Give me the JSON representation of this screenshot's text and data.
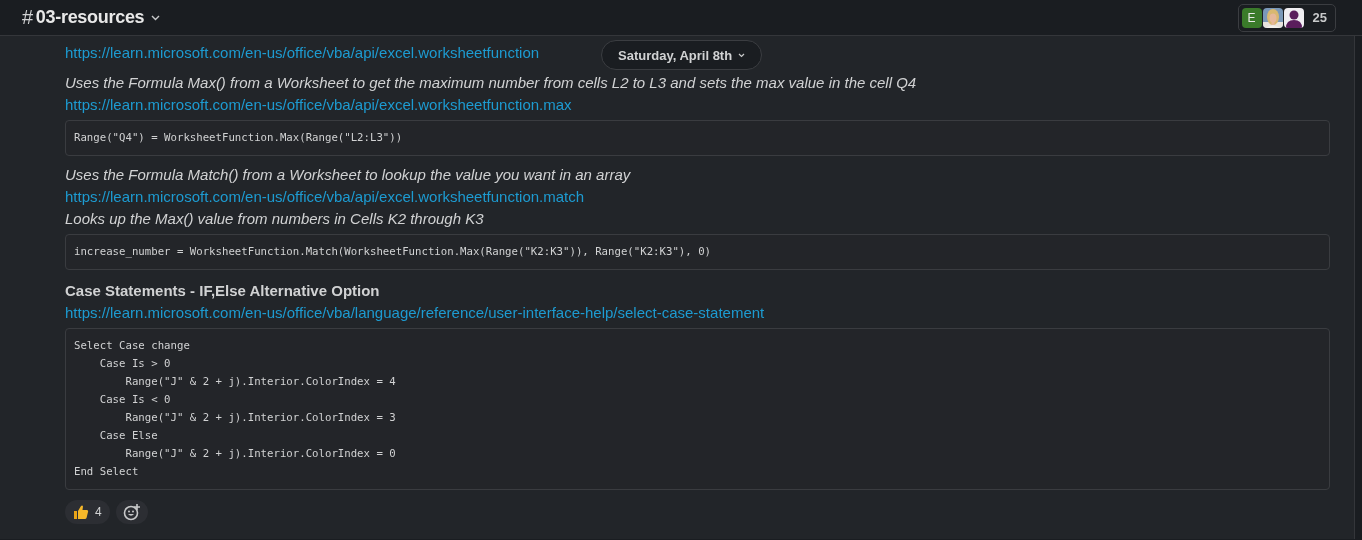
{
  "header": {
    "channel_prefix": "#",
    "channel_name": "03-resources",
    "avatars": [
      {
        "kind": "letter",
        "text": "E"
      },
      {
        "kind": "picture"
      },
      {
        "kind": "silhouette"
      }
    ],
    "member_count": "25"
  },
  "date_divider": "Saturday, April 8th",
  "blocks": [
    {
      "kind": "link",
      "text": "https://learn.microsoft.com/en-us/office/vba/api/excel.worksheetfunction"
    },
    {
      "kind": "note",
      "text": "Uses the Formula Max() from a Worksheet to get the maximum number from cells L2 to L3 and sets the max value in the cell Q4"
    },
    {
      "kind": "link",
      "text": "https://learn.microsoft.com/en-us/office/vba/api/excel.worksheetfunction.max"
    },
    {
      "kind": "code",
      "text": "Range(\"Q4\") = WorksheetFunction.Max(Range(\"L2:L3\"))"
    },
    {
      "kind": "note",
      "text": "Uses the Formula Match() from a Worksheet to lookup the value you want in an array"
    },
    {
      "kind": "link",
      "text": "https://learn.microsoft.com/en-us/office/vba/api/excel.worksheetfunction.match"
    },
    {
      "kind": "note",
      "text": "Looks up the Max() value from numbers in Cells K2 through K3"
    },
    {
      "kind": "code",
      "text": "increase_number = WorksheetFunction.Match(WorksheetFunction.Max(Range(\"K2:K3\")), Range(\"K2:K3\"), 0)"
    },
    {
      "kind": "heading",
      "text": "Case Statements - IF,Else Alternative Option"
    },
    {
      "kind": "link",
      "text": "https://learn.microsoft.com/en-us/office/vba/language/reference/user-interface-help/select-case-statement"
    },
    {
      "kind": "code",
      "text": "Select Case change\n    Case Is > 0\n        Range(\"J\" & 2 + j).Interior.ColorIndex = 4\n    Case Is < 0\n        Range(\"J\" & 2 + j).Interior.ColorIndex = 3\n    Case Else\n        Range(\"J\" & 2 + j).Interior.ColorIndex = 0\nEnd Select"
    }
  ],
  "reactions": [
    {
      "kind": "thumbs-up",
      "count": "4"
    }
  ]
}
